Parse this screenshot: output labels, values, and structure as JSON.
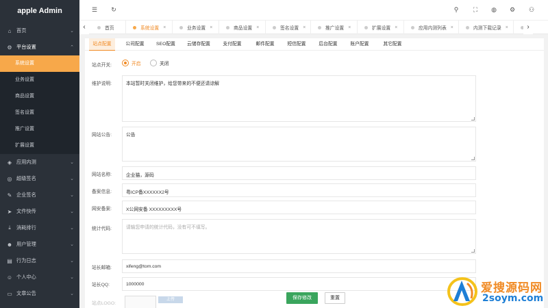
{
  "app": {
    "title": "apple Admin"
  },
  "sidebar": {
    "items": [
      {
        "label": "首页",
        "icon": "home-icon",
        "glyph": "⌂"
      },
      {
        "label": "平台设置",
        "icon": "gear-icon",
        "glyph": "⚙",
        "open": true,
        "children": [
          "系统设置",
          "业务设置",
          "商品设置",
          "签名设置",
          "推广设置",
          "扩展设置"
        ]
      },
      {
        "label": "应用内测",
        "icon": "tag-icon",
        "glyph": "◈"
      },
      {
        "label": "超级签名",
        "icon": "badge-icon",
        "glyph": "◎"
      },
      {
        "label": "企业签名",
        "icon": "edit-icon",
        "glyph": "✎"
      },
      {
        "label": "文件快传",
        "icon": "send-icon",
        "glyph": "➤"
      },
      {
        "label": "消耗排行",
        "icon": "download-icon",
        "glyph": "⤓"
      },
      {
        "label": "用户管理",
        "icon": "user-icon",
        "glyph": "☻"
      },
      {
        "label": "行为日志",
        "icon": "log-icon",
        "glyph": "▤"
      },
      {
        "label": "个人中心",
        "icon": "smile-icon",
        "glyph": "☺"
      },
      {
        "label": "文章公告",
        "icon": "monitor-icon",
        "glyph": "▭"
      }
    ]
  },
  "header": {
    "icons": [
      "menu-fold-icon",
      "refresh-icon",
      "search-icon",
      "fullscreen-icon",
      "globe-icon",
      "settings-icon",
      "user-icon"
    ]
  },
  "tabs": {
    "items": [
      {
        "label": "首页",
        "closable": false
      },
      {
        "label": "系统设置",
        "active": true
      },
      {
        "label": "业务设置"
      },
      {
        "label": "商品设置"
      },
      {
        "label": "签名设置"
      },
      {
        "label": "推广设置"
      },
      {
        "label": "扩展设置"
      },
      {
        "label": "应用内测列表"
      },
      {
        "label": "内测下载记录"
      }
    ]
  },
  "subtabs": [
    "站点配置",
    "公司配置",
    "SEO配置",
    "云储存配置",
    "支付配置",
    "邮件配置",
    "短信配置",
    "后台配置",
    "账户配置",
    "其它配置"
  ],
  "form": {
    "site_switch_label": "站点开关:",
    "switch_on": "开启",
    "switch_off": "关闭",
    "maintenance_label": "维护说明:",
    "maintenance_value": "本站暂时关闭维护，给您带来的不便还请谅解",
    "notice_label": "网站公告:",
    "notice_value": "公告",
    "site_name_label": "网站名称:",
    "site_name_value": "企业猫，源码",
    "icp_label": "备案信息:",
    "icp_value": "粤ICP备XXXXXX2号",
    "police_label": "网安备案:",
    "police_value": "X公网安备 XXXXXXXXX号",
    "stats_label": "统计代码:",
    "stats_placeholder": "请输您申请的统计代码，没有可不填写。",
    "email_label": "站长邮箱:",
    "email_value": "xifeng@tom.com",
    "qq_label": "站长QQ:",
    "qq_value": "1000000",
    "logo_label": "站点LOGO:",
    "upload_label": "上传",
    "save_label": "保存修改",
    "reset_label": "重置"
  },
  "watermark": {
    "line1": "爱搜源码网",
    "line2": "2soym.com"
  },
  "colors": {
    "accent": "#f08a24",
    "sidebar_bg": "#2b3139",
    "active_menu": "#f7a84a",
    "save_btn": "#3aa55d"
  }
}
